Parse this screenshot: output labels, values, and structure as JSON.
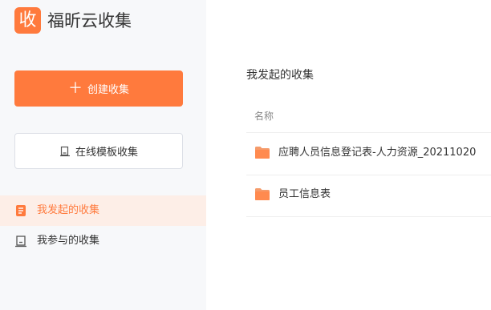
{
  "app": {
    "logo_char": "收",
    "title": "福昕云收集"
  },
  "sidebar": {
    "create_button_label": "创建收集",
    "template_button_label": "在线模板收集",
    "nav": [
      {
        "label": "我发起的收集",
        "active": true,
        "icon": "document-icon"
      },
      {
        "label": "我参与的收集",
        "active": false,
        "icon": "clipboard-icon"
      }
    ]
  },
  "main": {
    "title": "我发起的收集",
    "column_header": "名称",
    "rows": [
      {
        "name": "应聘人员信息登记表-人力资源_20211020",
        "icon": "folder-icon"
      },
      {
        "name": "员工信息表",
        "icon": "folder-icon"
      }
    ]
  },
  "colors": {
    "accent": "#ff7a3d",
    "active_bg": "#fdeee7",
    "sidebar_bg": "#f7f8fa"
  }
}
